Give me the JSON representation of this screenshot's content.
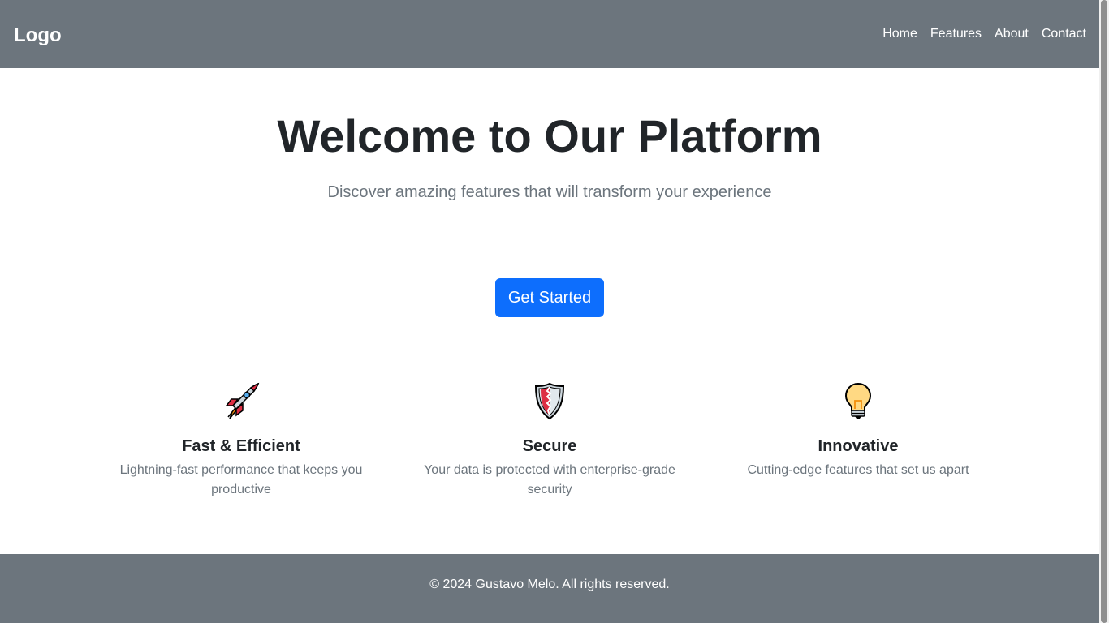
{
  "navbar": {
    "logo": "Logo",
    "links": [
      "Home",
      "Features",
      "About",
      "Contact"
    ]
  },
  "hero": {
    "title": "Welcome to Our Platform",
    "subtitle": "Discover amazing features that will transform your experience",
    "cta_label": "Get Started"
  },
  "features": [
    {
      "icon": "rocket-icon",
      "title": "Fast & Efficient",
      "text": "Lightning-fast performance that keeps you productive"
    },
    {
      "icon": "shield-icon",
      "title": "Secure",
      "text": "Your data is protected with enterprise-grade security"
    },
    {
      "icon": "lightbulb-icon",
      "title": "Innovative",
      "text": "Cutting-edge features that set us apart"
    }
  ],
  "footer": {
    "text": "© 2024 Gustavo Melo. All rights reserved."
  },
  "colors": {
    "navbar_bg": "#6c757d",
    "primary_button": "#0d6efd",
    "heading": "#212529",
    "muted_text": "#6c757d"
  }
}
